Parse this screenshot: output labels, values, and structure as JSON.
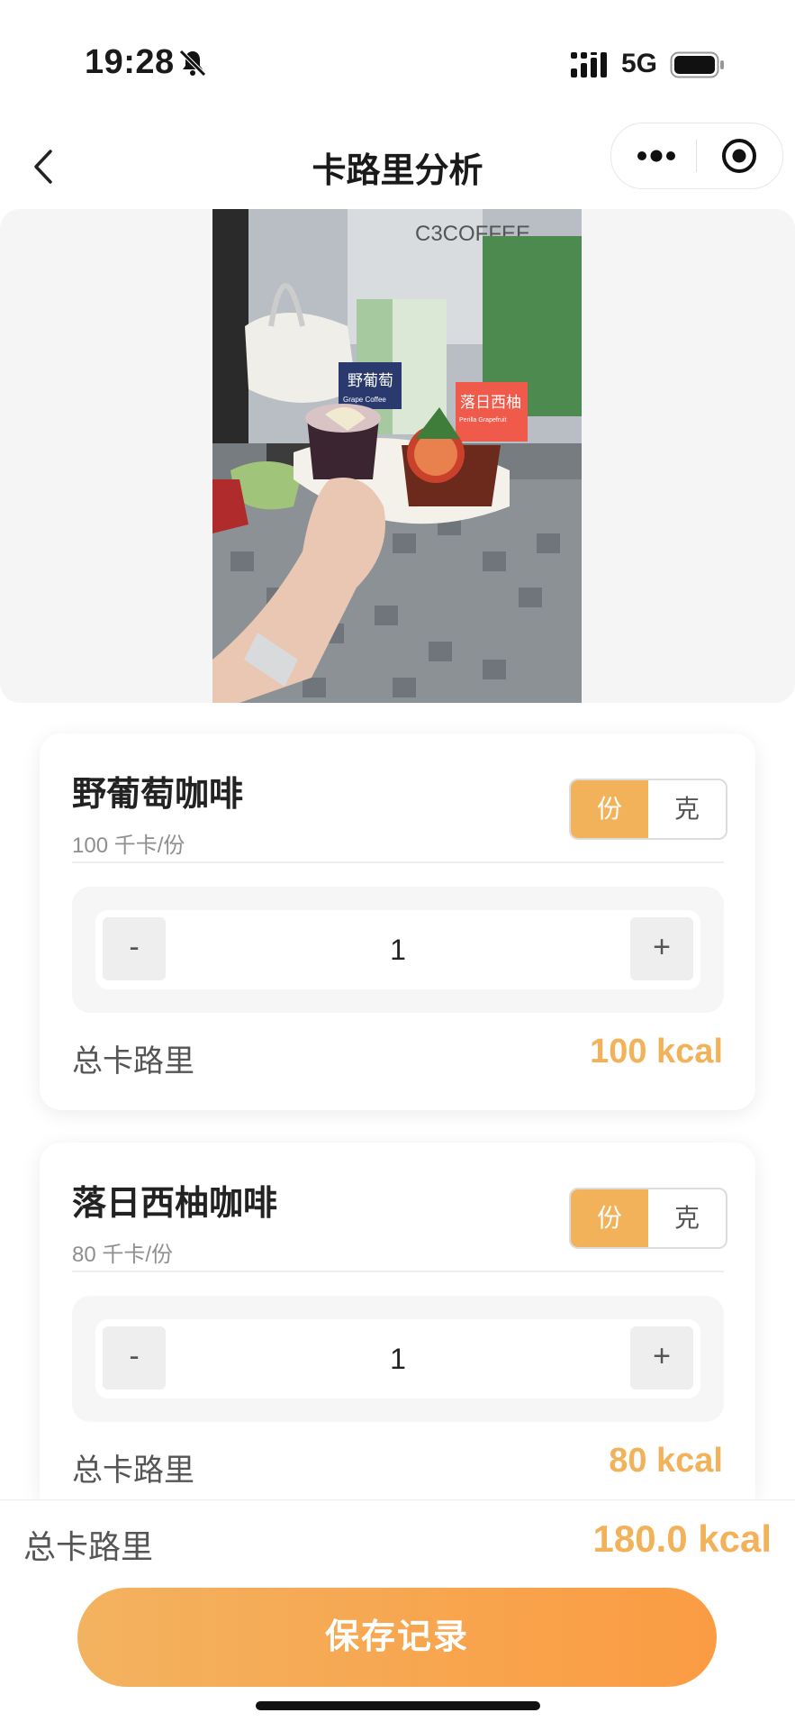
{
  "status_bar": {
    "time": "19:28",
    "network": "5G",
    "icons": [
      "bell-muted-icon",
      "signal-icon",
      "battery-icon"
    ]
  },
  "nav": {
    "title": "卡路里分析",
    "icons": [
      "back-chevron-icon",
      "more-dots-icon",
      "target-circle-icon"
    ]
  },
  "photo": {
    "sign_left": "野葡萄",
    "sign_left_sub": "Grape Coffee",
    "sign_right": "落日西柚",
    "sign_right_sub": "Perilla Grapefruit",
    "store": "C3COFFEE"
  },
  "items": [
    {
      "name": "野葡萄咖啡",
      "per_unit": "100 千卡/份",
      "unit_portion": "份",
      "unit_gram": "克",
      "minus": "-",
      "qty": "1",
      "plus": "+",
      "total_label": "总卡路里",
      "total_value": "100 kcal"
    },
    {
      "name": "落日西柚咖啡",
      "per_unit": "80 千卡/份",
      "unit_portion": "份",
      "unit_gram": "克",
      "minus": "-",
      "qty": "1",
      "plus": "+",
      "total_label": "总卡路里",
      "total_value": "80 kcal"
    }
  ],
  "summary": {
    "label": "总卡路里",
    "value": "180.0 kcal"
  },
  "save_button": "保存记录",
  "colors": {
    "accent": "#f2b25a",
    "button_start": "#f3b25f",
    "button_end": "#fb9c43",
    "panel": "#f5f5f5"
  }
}
